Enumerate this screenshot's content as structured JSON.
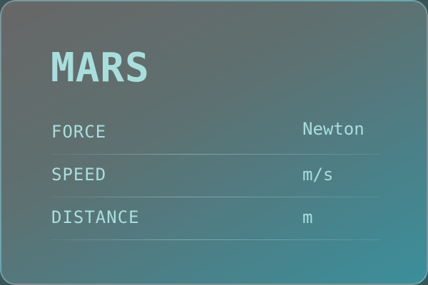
{
  "card": {
    "title": "MARS",
    "rows": [
      {
        "label": "FORCE",
        "unit": "Newton"
      },
      {
        "label": "SPEED",
        "unit": "m/s"
      },
      {
        "label": "DISTANCE",
        "unit": "m"
      }
    ]
  },
  "colors": {
    "text": "#a9dedd",
    "gradient_start": "#676767",
    "gradient_end": "#3a8f9b"
  }
}
